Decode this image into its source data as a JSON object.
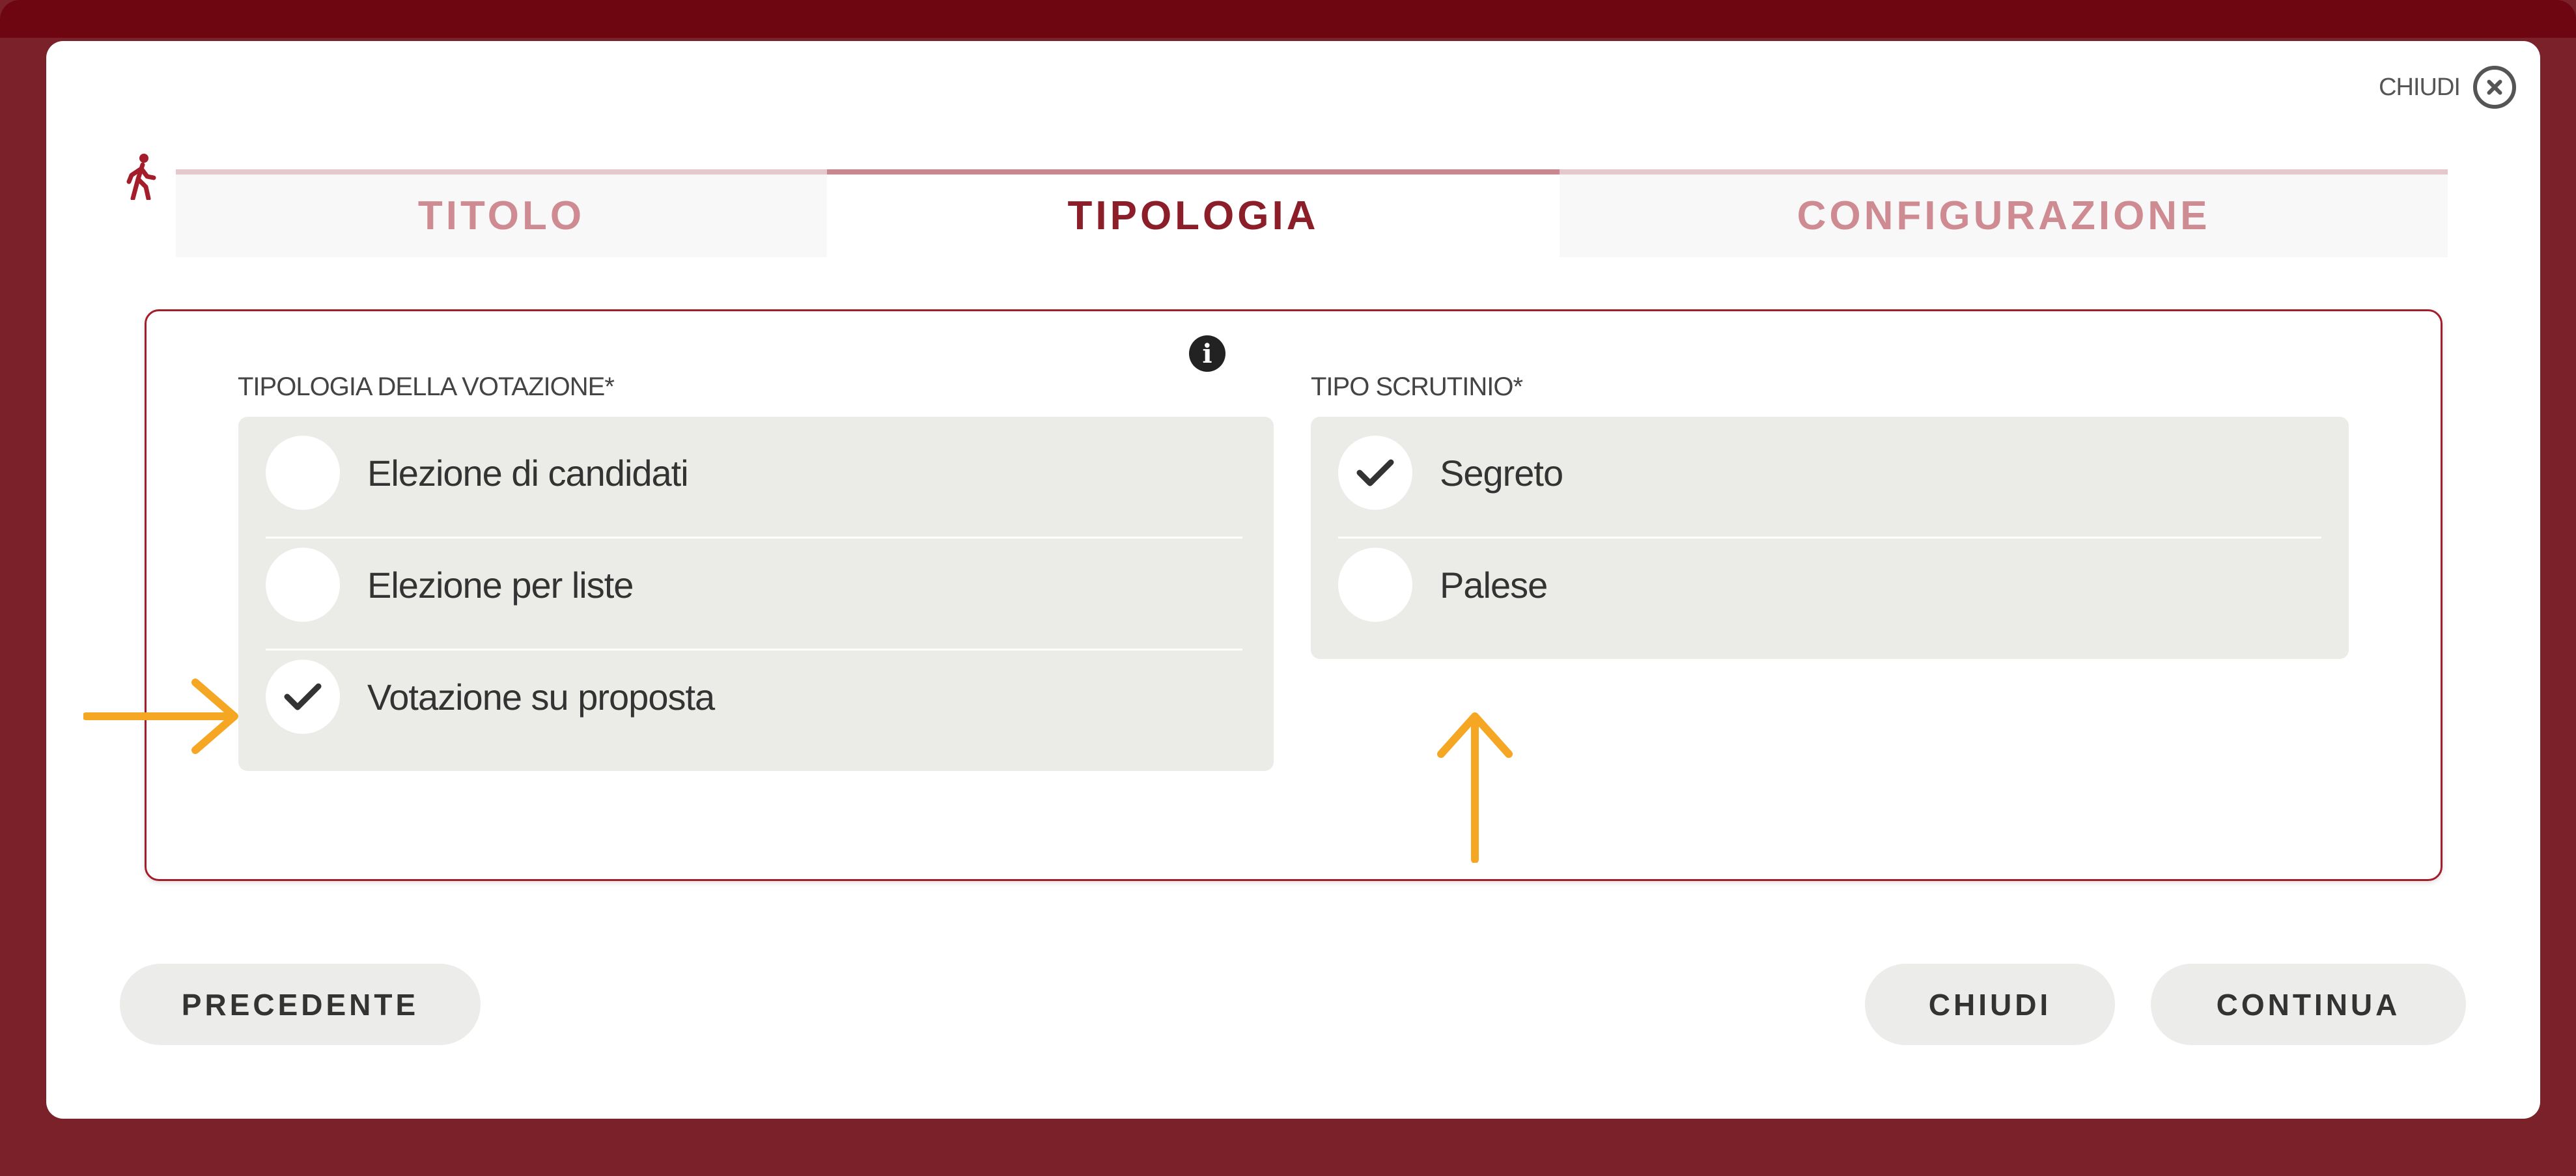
{
  "header": {
    "close_label": "CHIUDI"
  },
  "steps": [
    {
      "label": "TITOLO",
      "active": false
    },
    {
      "label": "TIPOLOGIA",
      "active": true
    },
    {
      "label": "CONFIGURAZIONE",
      "active": false
    }
  ],
  "voting_type": {
    "label": "TIPOLOGIA DELLA VOTAZIONE*",
    "options": [
      {
        "label": "Elezione di candidati",
        "selected": false
      },
      {
        "label": "Elezione per liste",
        "selected": false
      },
      {
        "label": "Votazione su proposta",
        "selected": true
      }
    ]
  },
  "ballot_type": {
    "label": "TIPO SCRUTINIO*",
    "options": [
      {
        "label": "Segreto",
        "selected": true
      },
      {
        "label": "Palese",
        "selected": false
      }
    ]
  },
  "footer": {
    "prev_label": "PRECEDENTE",
    "close_label": "CHIUDI",
    "continue_label": "CONTINUA"
  },
  "colors": {
    "brand": "#8c1e2a",
    "annotation_arrow": "#f5a623"
  },
  "icons": [
    "walking-person-icon",
    "close-circle-icon",
    "info-icon",
    "checkmark-icon"
  ]
}
